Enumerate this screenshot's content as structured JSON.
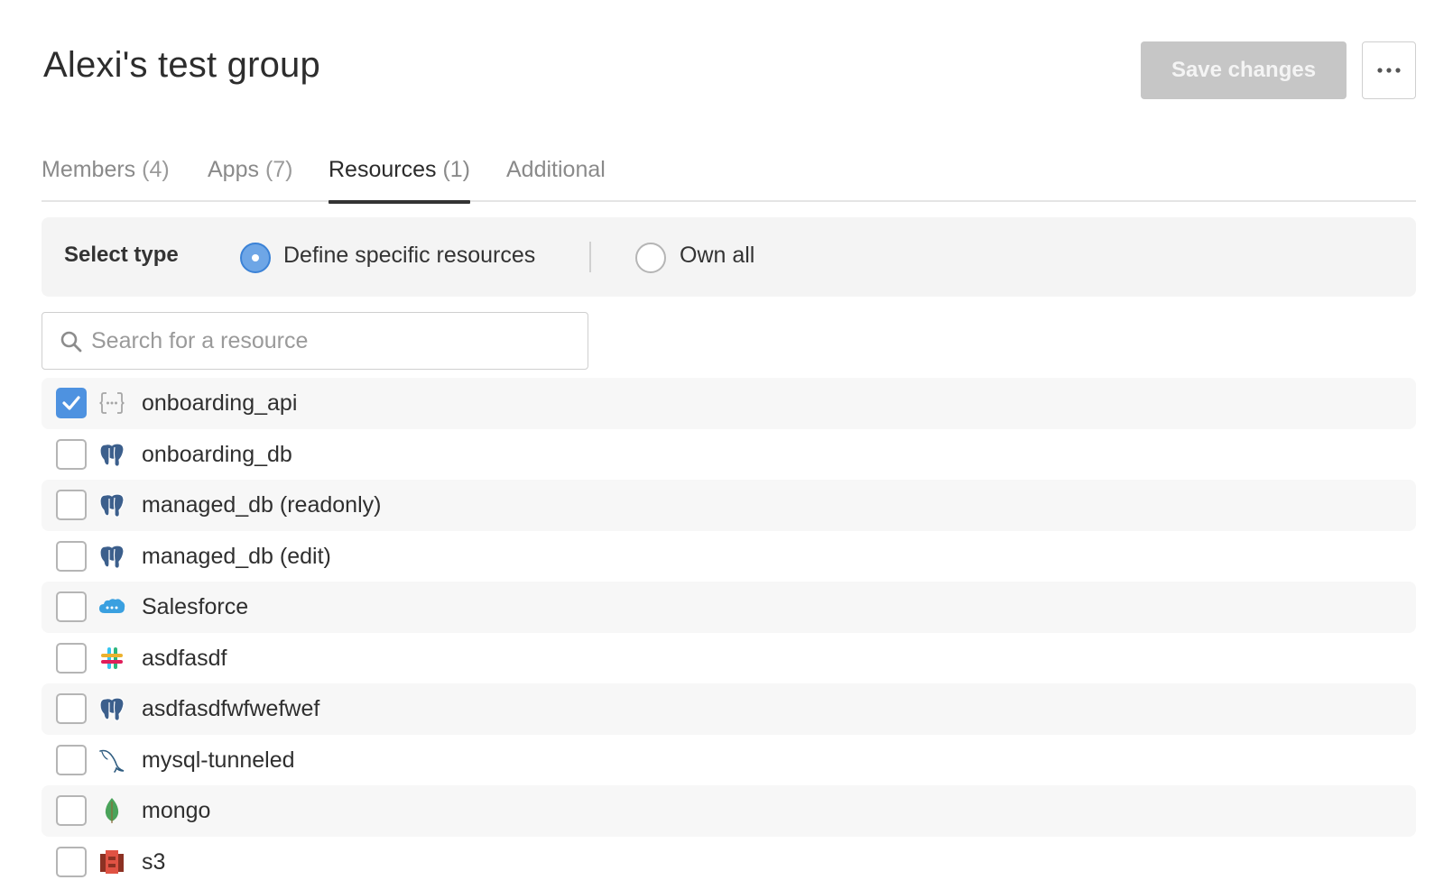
{
  "header": {
    "title": "Alexi's test group",
    "save_label": "Save changes",
    "more_icon": "ellipsis-icon"
  },
  "tabs": [
    {
      "label": "Members",
      "count": "(4)",
      "active": false
    },
    {
      "label": "Apps",
      "count": "(7)",
      "active": false
    },
    {
      "label": "Resources",
      "count": "(1)",
      "active": true
    },
    {
      "label": "Additional",
      "count": "",
      "active": false
    }
  ],
  "select_type": {
    "label": "Select type",
    "options": [
      {
        "label": "Define specific resources",
        "selected": true
      },
      {
        "label": "Own all",
        "selected": false
      }
    ]
  },
  "search": {
    "placeholder": "Search for a resource",
    "value": "",
    "icon": "search-icon"
  },
  "resources": [
    {
      "name": "onboarding_api",
      "icon": "rest-api-icon",
      "checked": true
    },
    {
      "name": "onboarding_db",
      "icon": "postgres-icon",
      "checked": false
    },
    {
      "name": "managed_db (readonly)",
      "icon": "postgres-icon",
      "checked": false
    },
    {
      "name": "managed_db (edit)",
      "icon": "postgres-icon",
      "checked": false
    },
    {
      "name": "Salesforce",
      "icon": "salesforce-icon",
      "checked": false
    },
    {
      "name": "asdfasdf",
      "icon": "slack-icon",
      "checked": false
    },
    {
      "name": "asdfasdfwfwefwef",
      "icon": "postgres-icon",
      "checked": false
    },
    {
      "name": "mysql-tunneled",
      "icon": "mysql-icon",
      "checked": false
    },
    {
      "name": "mongo",
      "icon": "mongodb-icon",
      "checked": false
    },
    {
      "name": "s3",
      "icon": "aws-s3-icon",
      "checked": false
    }
  ],
  "colors": {
    "accent": "#4e92e0",
    "save_disabled_bg": "#c6c6c6",
    "panel_bg": "#f4f4f4"
  }
}
